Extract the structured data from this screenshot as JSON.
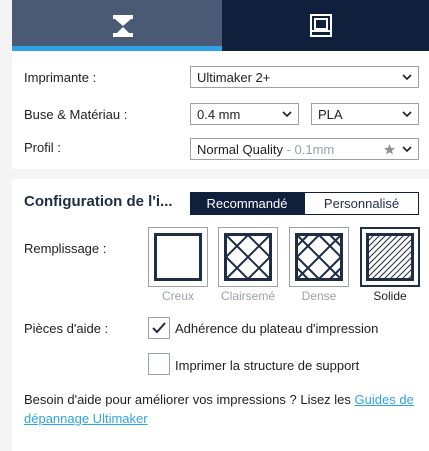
{
  "tabs": {
    "left_icon": "print-mode-icon",
    "right_icon": "monitor-icon"
  },
  "printer": {
    "label": "Imprimante :",
    "value": "Ultimaker 2+"
  },
  "nozzle_material": {
    "label": "Buse & Matériau :",
    "nozzle_value": "0.4 mm",
    "material_value": "PLA"
  },
  "profile": {
    "label": "Profil :",
    "value": "Normal Quality",
    "suffix": " - 0.1mm"
  },
  "config": {
    "title": "Configuration de l'i...",
    "tab_recommended": "Recommandé",
    "tab_custom": "Personnalisé"
  },
  "infill": {
    "label": "Remplissage :",
    "options": [
      "Creux",
      "Clairsemé",
      "Dense",
      "Solide"
    ],
    "selected": "Solide"
  },
  "support": {
    "label": "Pièces d'aide :",
    "adhesion_label": "Adhérence du plateau d'impression",
    "adhesion_checked": true,
    "support_label": "Imprimer la structure de support",
    "support_checked": false
  },
  "help": {
    "text": "Besoin d'aide pour améliorer vos impressions ? Lisez les ",
    "link_line1": "Guides de",
    "link_line2": "dépannage Ultimaker"
  },
  "colors": {
    "dark_navy": "#0f1f3c",
    "accent_blue": "#2fa3e6",
    "tab_active": "#4b5a74"
  }
}
